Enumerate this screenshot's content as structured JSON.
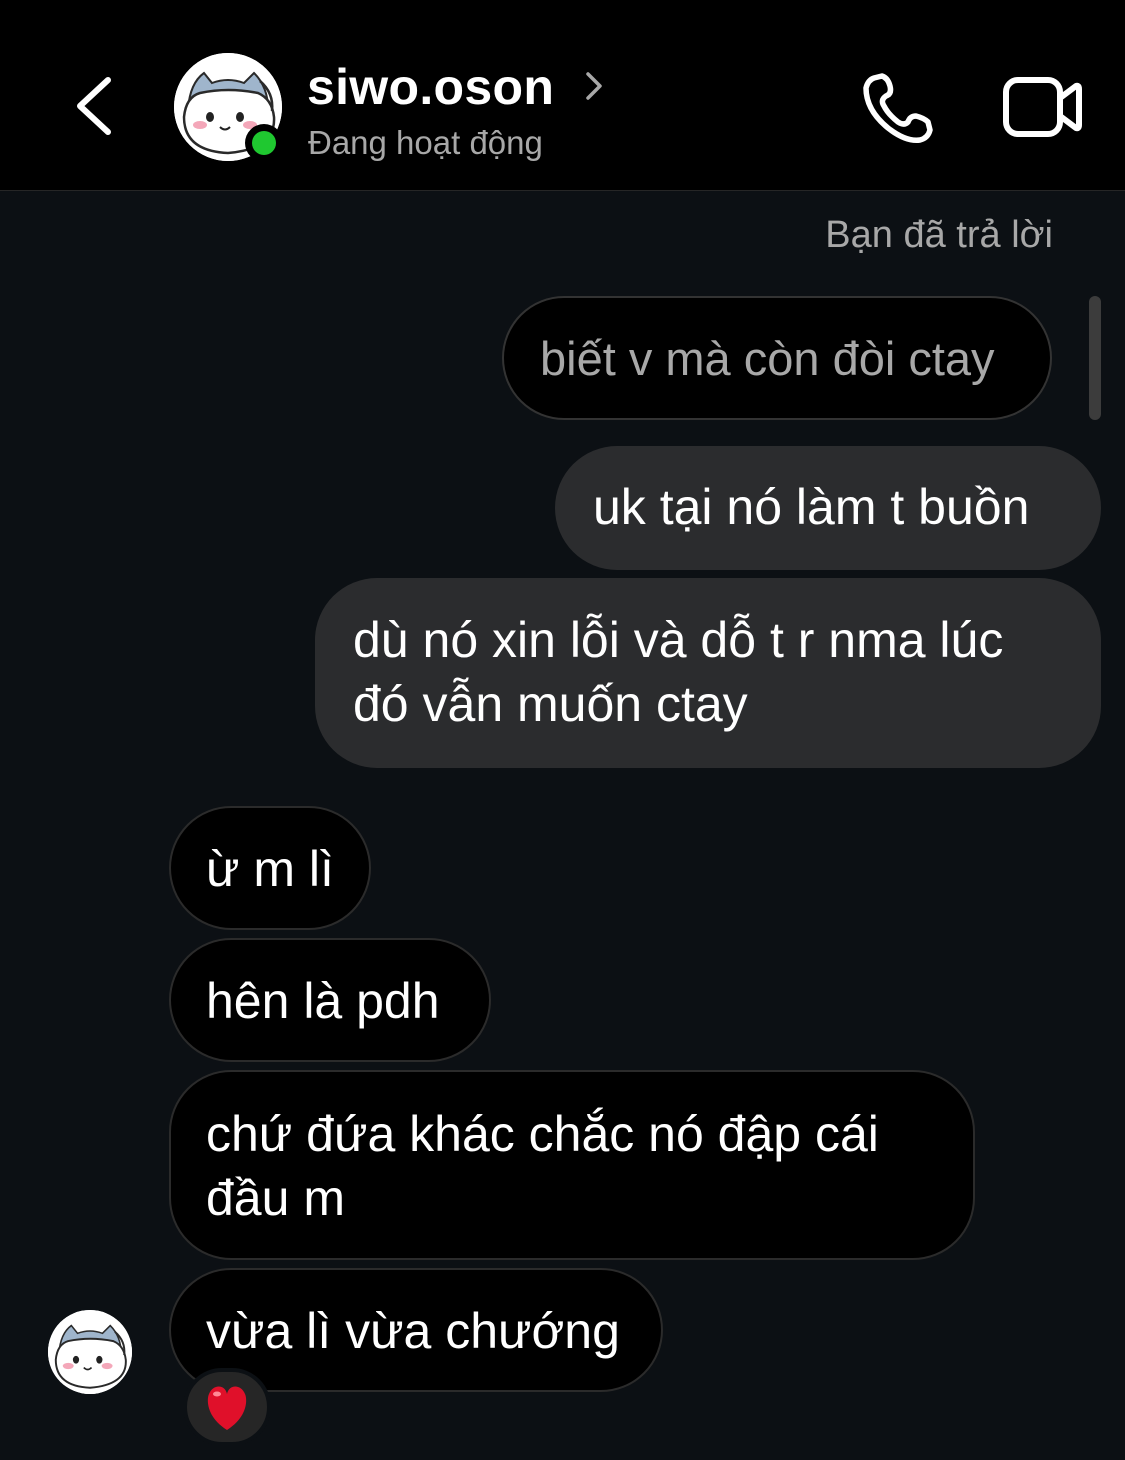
{
  "header": {
    "username": "siwo.oson",
    "status": "Đang hoạt động",
    "back_icon": "chevron-left-icon",
    "call_icon": "phone-icon",
    "video_icon": "video-camera-icon",
    "online_color": "#1fc830"
  },
  "thread": {
    "reply_note": "Bạn đã trả lời",
    "replied_message": "biết v mà còn đòi ctay",
    "outgoing": [
      {
        "lines": [
          "uk tại nó làm t buồn"
        ]
      },
      {
        "lines": [
          "dù nó xin lỗi và dỗ t r nma lúc",
          "đó vẫn muốn ctay"
        ]
      }
    ],
    "incoming": [
      {
        "lines": [
          "ừ m lì"
        ]
      },
      {
        "lines": [
          "hên là pdh"
        ]
      },
      {
        "lines": [
          "chứ đứa khác chắc nó đập cái",
          "đầu m"
        ]
      },
      {
        "lines": [
          "vừa lì vừa chướng"
        ]
      }
    ],
    "reaction": "heart-icon"
  },
  "colors": {
    "background": "#0c1014",
    "outgoing_bubble": "#2b2c2e",
    "incoming_bubble": "#000000",
    "secondary_text": "#a8a8a8",
    "heart": "#e0102a"
  }
}
